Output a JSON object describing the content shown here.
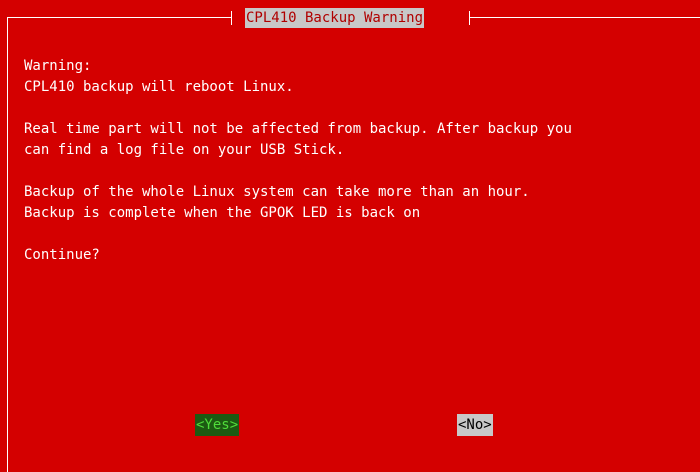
{
  "dialog": {
    "title": "CPL410 Backup Warning",
    "lines": [
      "Warning:",
      "CPL410 backup will reboot Linux.",
      "",
      "Real time part will not be affected from backup. After backup you",
      "can find a log file on your USB Stick.",
      "",
      "Backup of the whole Linux system can take more than an hour.",
      "Backup is complete when the GPOK LED is back on",
      "",
      "Continue?"
    ],
    "buttons": {
      "yes_label": "<Yes>",
      "no_label": "<No>"
    }
  },
  "colors": {
    "background": "#d40000",
    "text": "#ffffff",
    "title_bg": "#c8c8c8",
    "title_fg": "#b00000",
    "yes_bg": "#1c5a12",
    "yes_fg": "#4fdc3a",
    "no_bg": "#c8c8c8",
    "no_fg": "#000000"
  }
}
